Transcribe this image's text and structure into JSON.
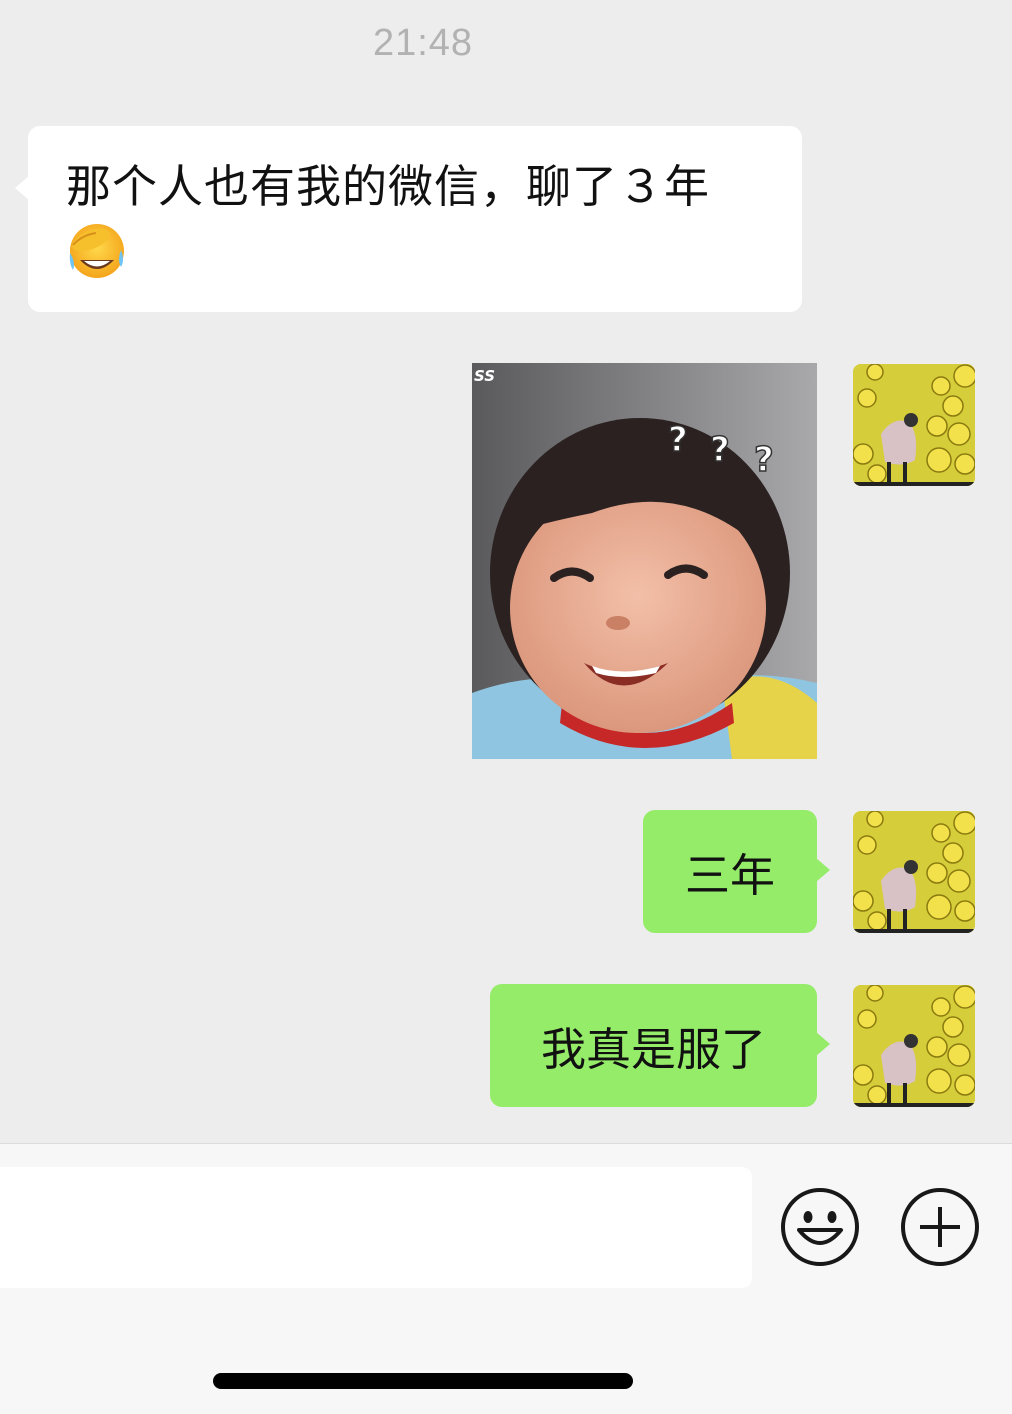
{
  "timestamp": "21:48",
  "messages": [
    {
      "side": "left",
      "type": "text",
      "text": "那个人也有我的微信，聊了３年",
      "emoji": "face-with-hand-over-eyes-emoji"
    },
    {
      "side": "right",
      "type": "sticker",
      "sticker_text": "SS",
      "sticker_marks": "? ? ?"
    },
    {
      "side": "right",
      "type": "text",
      "text": "三年"
    },
    {
      "side": "right",
      "type": "text",
      "text": "我真是服了"
    }
  ],
  "input": {
    "value": "",
    "icons": [
      "smiley-icon",
      "plus-circle-icon"
    ]
  },
  "colors": {
    "background": "#EDEDED",
    "incoming_bubble": "#FFFFFF",
    "outgoing_bubble": "#95EC69",
    "timestamp": "#B2B2B2",
    "input_bar": "#F7F7F7"
  }
}
